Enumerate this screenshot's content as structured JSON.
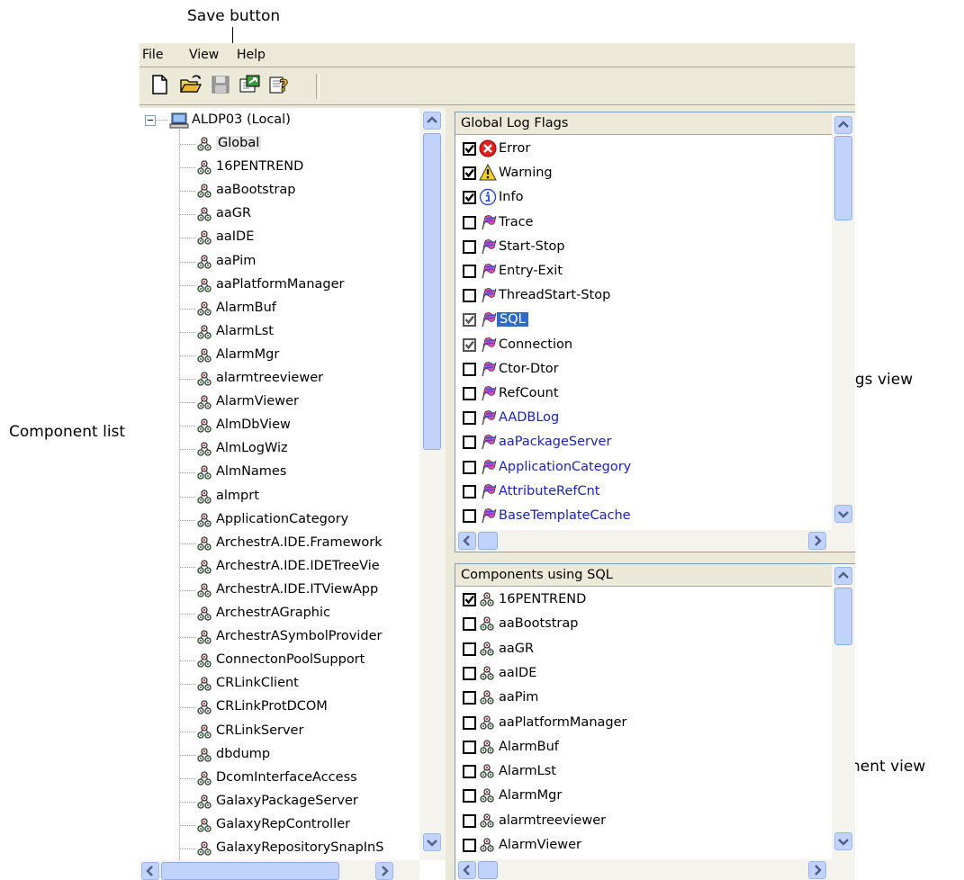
{
  "callouts": {
    "save_button": "Save button",
    "component_list": "Component list",
    "log_flags_view": "Log flags view",
    "component_view": "Component view"
  },
  "menu": {
    "file": "File",
    "view": "View",
    "help": "Help"
  },
  "toolbar_icons": [
    "new-icon",
    "open-icon",
    "save-icon",
    "apply-icon",
    "help-icon"
  ],
  "tree": {
    "root": "ALDP03 (Local)",
    "items": [
      "Global",
      "16PENTREND",
      "aaBootstrap",
      "aaGR",
      "aaIDE",
      "aaPim",
      "aaPlatformManager",
      "AlarmBuf",
      "AlarmLst",
      "AlarmMgr",
      "alarmtreeviewer",
      "AlarmViewer",
      "AlmDbView",
      "AlmLogWiz",
      "AlmNames",
      "almprt",
      "ApplicationCategory",
      "ArchestrA.IDE.Framework",
      "ArchestrA.IDE.IDETreeVie",
      "ArchestrA.IDE.ITViewApp",
      "ArchestrAGraphic",
      "ArchestrASymbolProvider",
      "ConnectonPoolSupport",
      "CRLinkClient",
      "CRLinkProtDCOM",
      "CRLinkServer",
      "dbdump",
      "DcomInterfaceAccess",
      "GalaxyPackageServer",
      "GalaxyRepController",
      "GalaxyRepositorySnapInS"
    ],
    "selected": "Global"
  },
  "log_flags": {
    "header": "Global Log Flags",
    "items": [
      {
        "label": "Error",
        "checked": true,
        "icon": "error-icon"
      },
      {
        "label": "Warning",
        "checked": true,
        "icon": "warning-icon"
      },
      {
        "label": "Info",
        "checked": true,
        "icon": "info-icon"
      },
      {
        "label": "Trace",
        "checked": false,
        "icon": "flag-icon"
      },
      {
        "label": "Start-Stop",
        "checked": false,
        "icon": "flag-icon"
      },
      {
        "label": "Entry-Exit",
        "checked": false,
        "icon": "flag-icon"
      },
      {
        "label": "ThreadStart-Stop",
        "checked": false,
        "icon": "flag-icon"
      },
      {
        "label": "SQL",
        "checked": true,
        "gray": true,
        "selected": true,
        "icon": "flag-icon"
      },
      {
        "label": "Connection",
        "checked": true,
        "gray": true,
        "icon": "flag-icon"
      },
      {
        "label": "Ctor-Dtor",
        "checked": false,
        "icon": "flag-icon"
      },
      {
        "label": "RefCount",
        "checked": false,
        "icon": "flag-icon"
      },
      {
        "label": "AADBLog",
        "checked": false,
        "custom": true,
        "icon": "flag-icon"
      },
      {
        "label": "aaPackageServer",
        "checked": false,
        "custom": true,
        "icon": "flag-icon"
      },
      {
        "label": "ApplicationCategory",
        "checked": false,
        "custom": true,
        "icon": "flag-icon"
      },
      {
        "label": "AttributeRefCnt",
        "checked": false,
        "custom": true,
        "icon": "flag-icon"
      },
      {
        "label": "BaseTemplateCache",
        "checked": false,
        "custom": true,
        "icon": "flag-icon"
      }
    ]
  },
  "components": {
    "header": "Components using SQL",
    "items": [
      {
        "label": "16PENTREND",
        "checked": true
      },
      {
        "label": "aaBootstrap",
        "checked": false
      },
      {
        "label": "aaGR",
        "checked": false
      },
      {
        "label": "aaIDE",
        "checked": false
      },
      {
        "label": "aaPim",
        "checked": false
      },
      {
        "label": "aaPlatformManager",
        "checked": false
      },
      {
        "label": "AlarmBuf",
        "checked": false
      },
      {
        "label": "AlarmLst",
        "checked": false
      },
      {
        "label": "AlarmMgr",
        "checked": false
      },
      {
        "label": "alarmtreeviewer",
        "checked": false
      },
      {
        "label": "AlarmViewer",
        "checked": false
      }
    ]
  },
  "colors": {
    "link": "#1a22b6",
    "selection": "#316ac5",
    "window": "#ece9d8"
  }
}
